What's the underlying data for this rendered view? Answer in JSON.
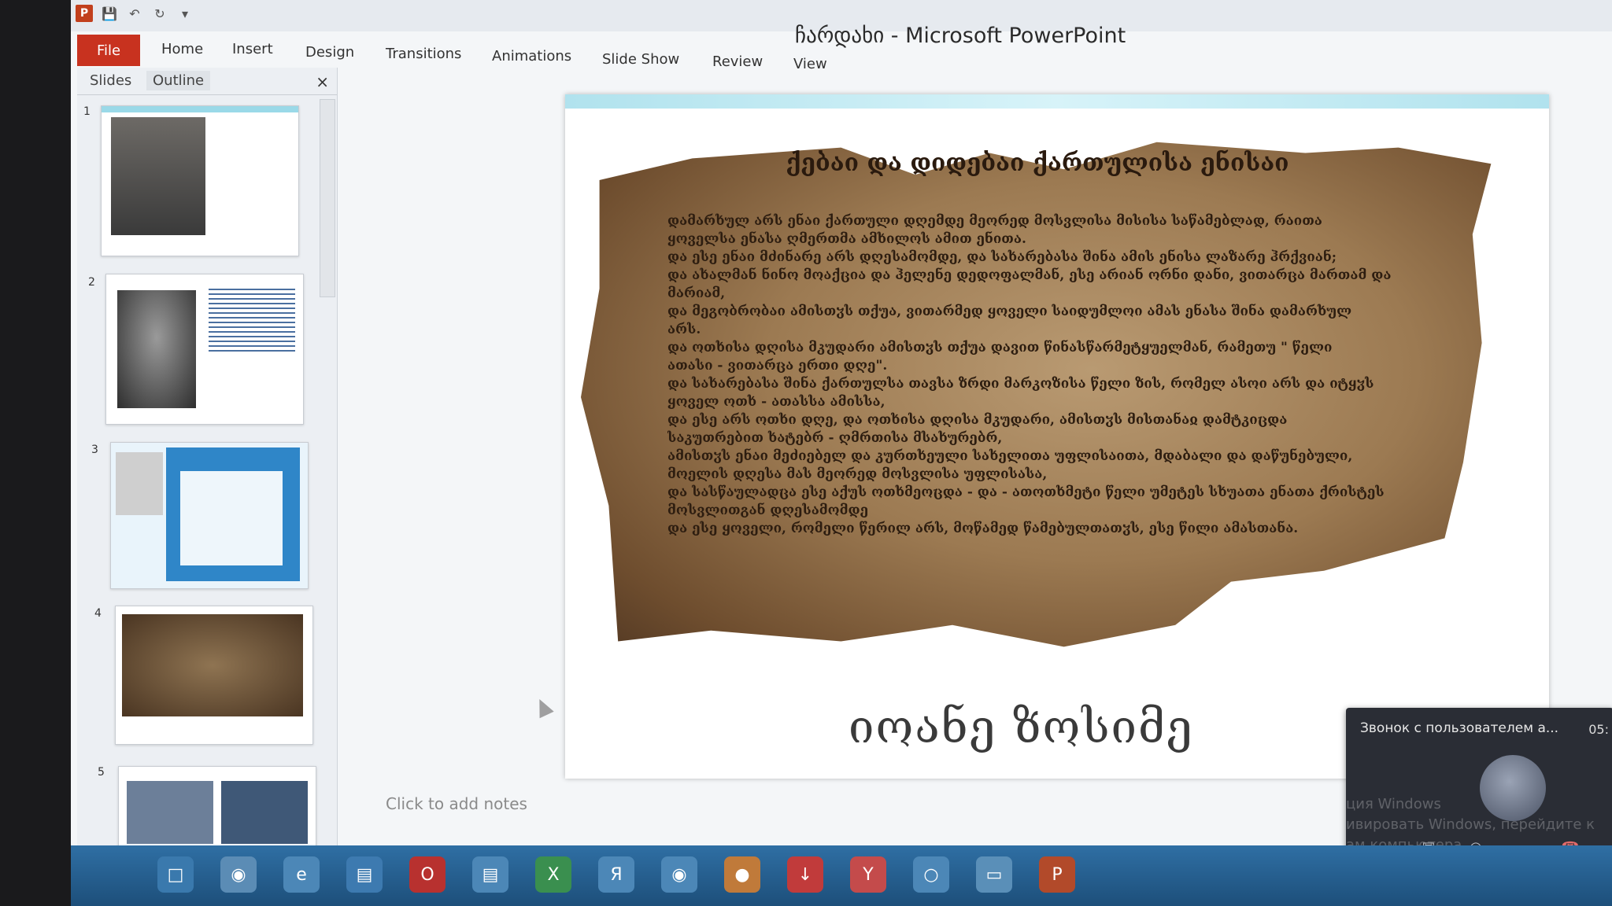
{
  "window": {
    "title": "ჩარდახი - Microsoft PowerPoint"
  },
  "ribbon": {
    "tabs": [
      "File",
      "Home",
      "Insert",
      "Design",
      "Transitions",
      "Animations",
      "Slide Show",
      "Review",
      "View"
    ]
  },
  "left_panel": {
    "tab_slides": "Slides",
    "tab_outline": "Outline",
    "close": "×",
    "slide_numbers": [
      "1",
      "2",
      "3",
      "4",
      "5"
    ]
  },
  "slide": {
    "title": "ქებაი და დიდებაი ქართულისა ენისაი",
    "body_lines": [
      "დამარხულ არს ენაი ქართული დღემდე მეორედ მოსვლისა მისისა საწამებლად, რაითა",
      "ყოველსა ენასა ღმერთმა ამხილოს ამით ენითა.",
      "და ესე ენაი მძინარე არს დღესამომდე, და სახარებასა შინა ამის ენისა ლაზარე ჰრქვიან;",
      "და ახალმან ნინო მოაქცია და ჰელენე დედოფალმან, ესე არიან ორნი დანი, ვითარცა მართამ და",
      "მარიამ,",
      "და მეგობრობაი ამისთჳს თქუა, ვითარმედ ყოველი საიდუმლოი ამას ენასა შინა დამარხულ",
      "არს.",
      "და ოთხისა დღისა მკუდარი ამისთჳს თქუა დავით წინასწარმეტყუელმან, რამეთუ \" წელი",
      "ათასი - ვითარცა ერთი დღე\".",
      "და სახარებასა შინა ქართულსა თავსა ზრდი მარკოზისა წელი ზის, რომელ ასოი არს და იტყჳს",
      "ყოველ ოთხ - ათასსა ამისსა,",
      "და ესე არს ოთხი დღე, და ოთხისა დღისა მკუდარი, ამისთჳს მისთანაჲ დამტკიცდა",
      "საკუთრებით ხატებრ - ღმრთისა მსახურებრ,",
      "ამისთჳს ენაი მეძიებელ და კურთხეული სახელითა უფლისაითა, მდაბალი და დაწუნებული,",
      "მოელის დღესა მას მეორედ მოსვლისა უფლისასა,",
      "და სასწაულადცა ესე აქუს ოთხმეოცდა - და - ათოთხმეტი წელი უმეტეს სხუათა ენათა ქრისტეს",
      "მოსვლითგან დღესამომდე",
      "და ესე ყოველი, რომელი წერილ არს, მოწამედ წამებულთათჳს, ესე წილი ამასთანა."
    ],
    "author": "იოანე ზოსიმე",
    "notes_placeholder": "Click to add notes"
  },
  "call_overlay": {
    "title": "Звонок с пользователем a...",
    "time": "05:",
    "watermark_lines": [
      "ция Windows",
      "ивировать Windows, перейдите к",
      "ам компьютера"
    ]
  }
}
